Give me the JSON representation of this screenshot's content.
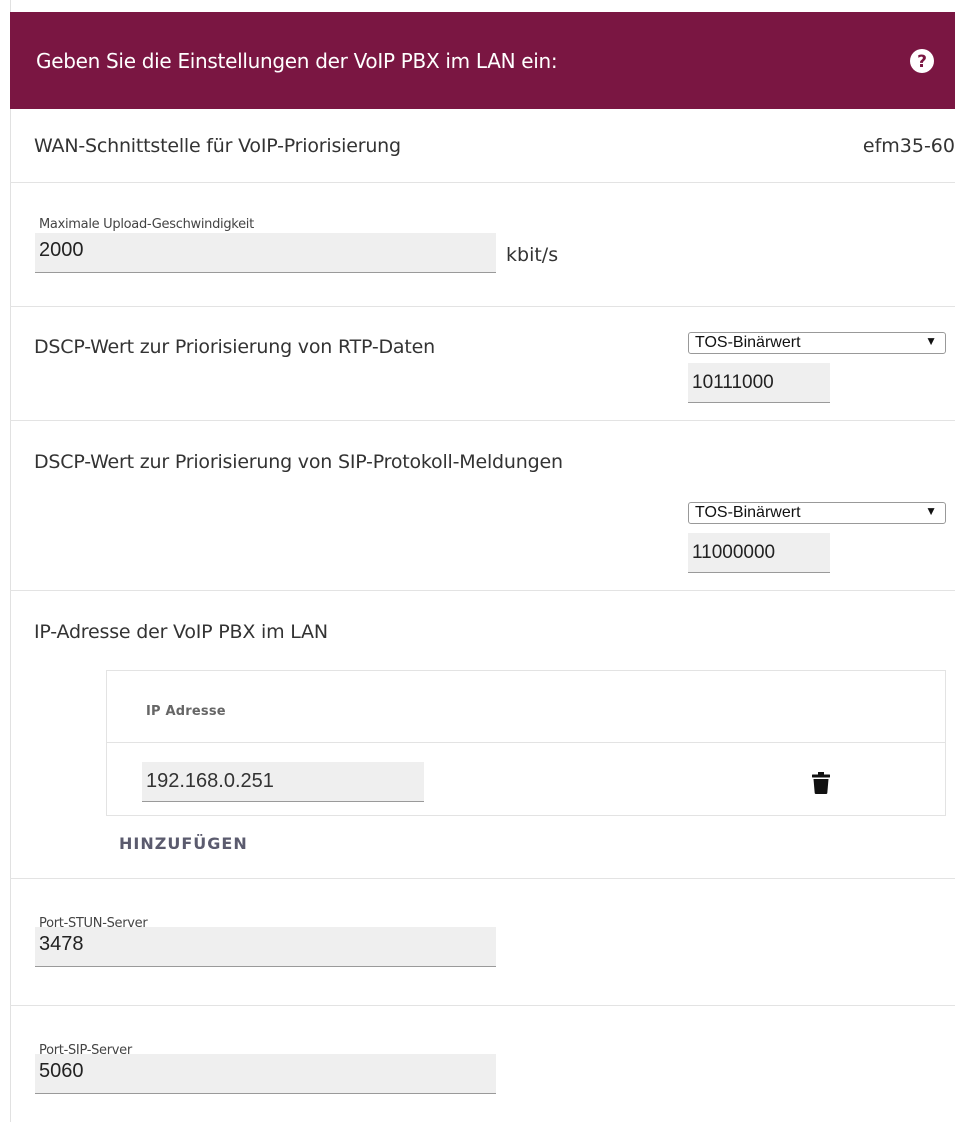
{
  "header": {
    "title": "Geben Sie die Einstellungen der VoIP PBX im LAN ein:",
    "help_icon": "question-circle-icon"
  },
  "wan": {
    "label": "WAN-Schnittstelle für VoIP-Priorisierung",
    "value": "efm35-60"
  },
  "upload": {
    "label": "Maximale Upload-Geschwindigkeit",
    "value": "2000",
    "unit": "kbit/s"
  },
  "rtp": {
    "label": "DSCP-Wert zur Priorisierung von RTP-Daten",
    "select_value": "TOS-Binärwert",
    "value": "10111000"
  },
  "sip": {
    "label": "DSCP-Wert zur Priorisierung von SIP-Protokoll-Meldungen",
    "select_value": "TOS-Binärwert",
    "value": "11000000"
  },
  "ip": {
    "label": "IP-Adresse der VoIP PBX im LAN",
    "column_header": "IP Adresse",
    "rows": [
      {
        "value": "192.168.0.251",
        "delete_icon": "trash-icon"
      }
    ],
    "add_label": "HINZUFÜGEN"
  },
  "stun": {
    "label": "Port-STUN-Server",
    "value": "3478"
  },
  "sip_port": {
    "label": "Port-SIP-Server",
    "value": "5060"
  },
  "colors": {
    "header_bg": "#7a1642",
    "field_bg": "#efefef"
  }
}
